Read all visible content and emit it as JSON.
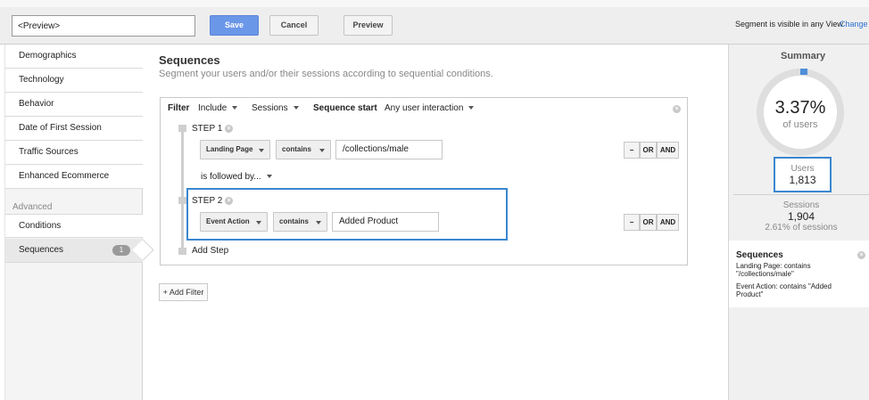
{
  "header": {
    "segment_name": "<Preview>",
    "save_label": "Save",
    "cancel_label": "Cancel",
    "preview_label": "Preview",
    "visibility_text": "Segment is visible in any View",
    "change_label": "Change"
  },
  "sidebar": {
    "items": [
      {
        "label": "Demographics"
      },
      {
        "label": "Technology"
      },
      {
        "label": "Behavior"
      },
      {
        "label": "Date of First Session"
      },
      {
        "label": "Traffic Sources"
      },
      {
        "label": "Enhanced Ecommerce"
      }
    ],
    "advanced_label": "Advanced",
    "advanced_items": [
      {
        "label": "Conditions"
      },
      {
        "label": "Sequences",
        "badge": "1"
      }
    ]
  },
  "main": {
    "title": "Sequences",
    "subtitle": "Segment your users and/or their sessions according to sequential conditions.",
    "filter_label": "Filter",
    "include_value": "Include",
    "scope_value": "Sessions",
    "sequence_start_label": "Sequence start",
    "sequence_start_value": "Any user interaction",
    "steps": [
      {
        "label": "STEP 1",
        "dimension": "Landing Page",
        "operator": "contains",
        "value": "/collections/male"
      },
      {
        "label": "STEP 2",
        "dimension": "Event Action",
        "operator": "contains",
        "value": "Added Product"
      }
    ],
    "followed_by": "is followed by...",
    "minus_label": "−",
    "or_label": "OR",
    "and_label": "AND",
    "add_step_label": "Add Step",
    "add_filter_label": "+ Add Filter"
  },
  "summary": {
    "title": "Summary",
    "percent": "3.37%",
    "of_users": "of users",
    "users_label": "Users",
    "users_value": "1,813",
    "sessions_label": "Sessions",
    "sessions_value": "1,904",
    "sessions_pct": "2.61% of sessions",
    "sequences_title": "Sequences",
    "sequences_lines": [
      "Landing Page: contains \"/collections/male\"",
      "Event Action: contains \"Added Product\""
    ]
  },
  "colors": {
    "accent": "#3a87d0",
    "save_button": "#6b97e8",
    "link": "#2b6fd1"
  },
  "icons": [
    "remove-circle-icon",
    "dropdown-caret-icon",
    "step-marker-icon",
    "sidebar-arrow-icon"
  ]
}
